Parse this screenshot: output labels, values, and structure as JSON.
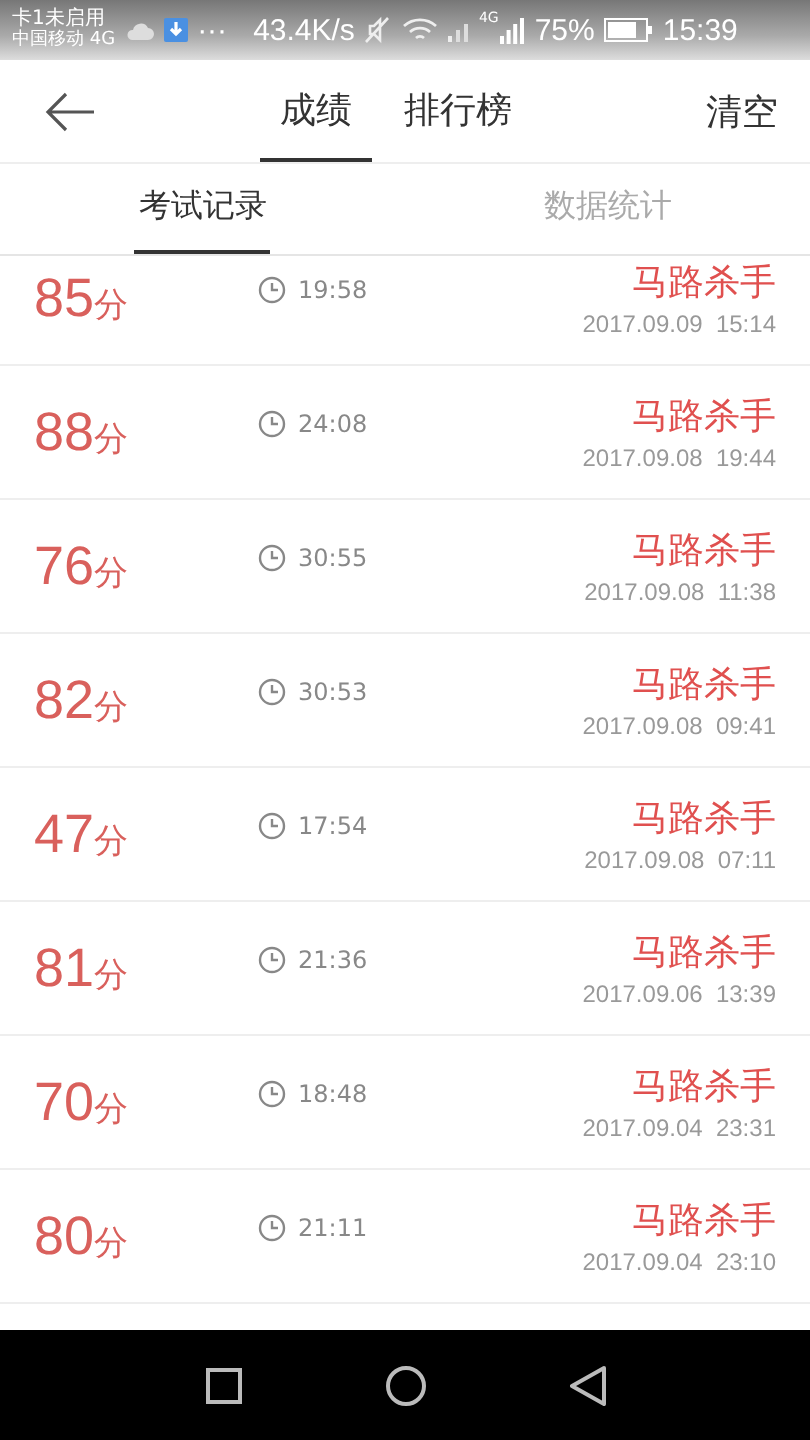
{
  "status_bar": {
    "sim_status": "卡1未启用",
    "carrier": "中国移动 4G",
    "more": "···",
    "speed": "43.4K/s",
    "network": "4G",
    "battery": "75%",
    "time": "15:39"
  },
  "header": {
    "tabs": [
      {
        "label": "成绩",
        "selected": true
      },
      {
        "label": "排行榜",
        "selected": false
      }
    ],
    "action": "清空"
  },
  "sub_tabs": [
    {
      "label": "考试记录",
      "selected": true
    },
    {
      "label": "数据统计",
      "selected": false
    }
  ],
  "records": [
    {
      "score": "85",
      "unit": "分",
      "duration": "19:58",
      "name": "马路杀手",
      "date": "2017.09.09  15:14"
    },
    {
      "score": "88",
      "unit": "分",
      "duration": "24:08",
      "name": "马路杀手",
      "date": "2017.09.08  19:44"
    },
    {
      "score": "76",
      "unit": "分",
      "duration": "30:55",
      "name": "马路杀手",
      "date": "2017.09.08  11:38"
    },
    {
      "score": "82",
      "unit": "分",
      "duration": "30:53",
      "name": "马路杀手",
      "date": "2017.09.08  09:41"
    },
    {
      "score": "47",
      "unit": "分",
      "duration": "17:54",
      "name": "马路杀手",
      "date": "2017.09.08  07:11"
    },
    {
      "score": "81",
      "unit": "分",
      "duration": "21:36",
      "name": "马路杀手",
      "date": "2017.09.06  13:39"
    },
    {
      "score": "70",
      "unit": "分",
      "duration": "18:48",
      "name": "马路杀手",
      "date": "2017.09.04  23:31"
    },
    {
      "score": "80",
      "unit": "分",
      "duration": "21:11",
      "name": "马路杀手",
      "date": "2017.09.04  23:10"
    }
  ]
}
